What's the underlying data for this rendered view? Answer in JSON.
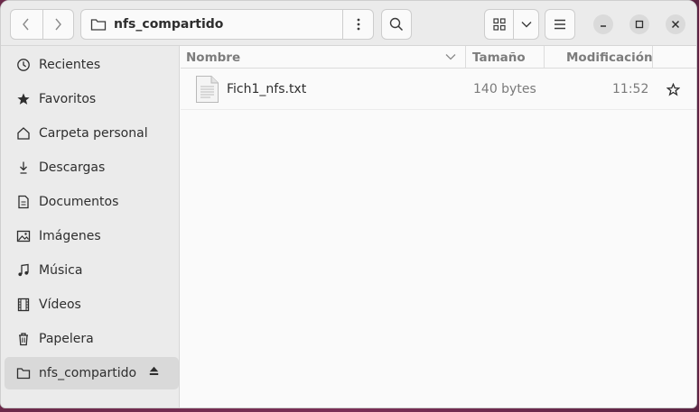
{
  "path": {
    "current": "nfs_compartido"
  },
  "sidebar": {
    "items": [
      {
        "label": "Recientes",
        "icon": "clock-icon"
      },
      {
        "label": "Favoritos",
        "icon": "star-icon"
      },
      {
        "label": "Carpeta personal",
        "icon": "home-icon"
      },
      {
        "label": "Descargas",
        "icon": "download-icon"
      },
      {
        "label": "Documentos",
        "icon": "document-icon"
      },
      {
        "label": "Imágenes",
        "icon": "image-icon"
      },
      {
        "label": "Música",
        "icon": "music-icon"
      },
      {
        "label": "Vídeos",
        "icon": "video-icon"
      },
      {
        "label": "Papelera",
        "icon": "trash-icon"
      },
      {
        "label": "nfs_compartido",
        "icon": "folder-icon",
        "active": true
      }
    ]
  },
  "list": {
    "columns": {
      "name": "Nombre",
      "size": "Tamaño",
      "modified": "Modificación"
    },
    "rows": [
      {
        "name": "Fich1_nfs.txt",
        "size": "140 bytes",
        "modified": "11:52"
      }
    ]
  },
  "colors": {
    "window_bg": "#fafafa",
    "headerbar_bg": "#ebebeb",
    "desktop_bg": "#6b2a4a"
  }
}
